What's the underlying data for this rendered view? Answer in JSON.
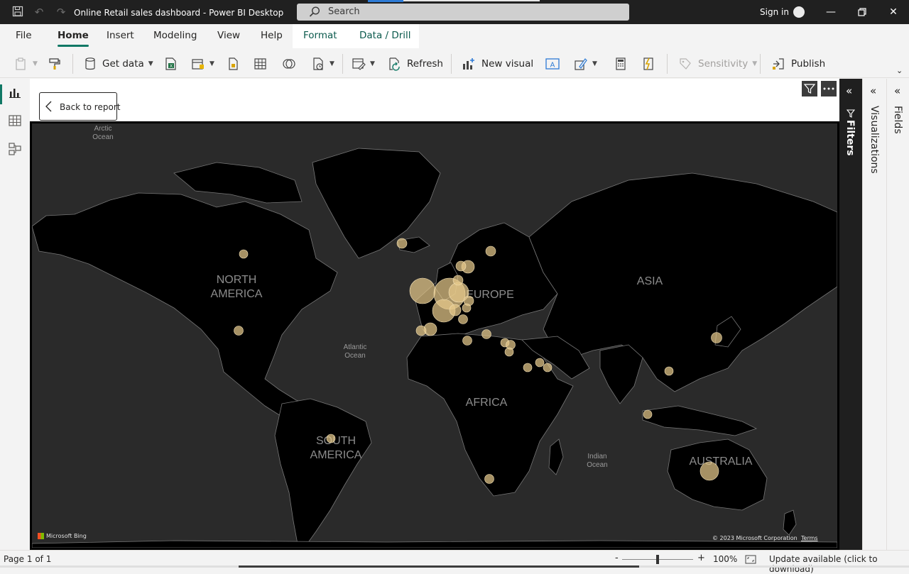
{
  "window": {
    "title": "Online Retail sales dashboard - Power BI Desktop",
    "search_placeholder": "Search",
    "sign_in": "Sign in"
  },
  "menu": {
    "file": "File",
    "home": "Home",
    "insert": "Insert",
    "modeling": "Modeling",
    "view": "View",
    "help": "Help",
    "format": "Format",
    "data_drill": "Data / Drill"
  },
  "ribbon": {
    "get_data": "Get data",
    "refresh": "Refresh",
    "new_visual": "New visual",
    "sensitivity": "Sensitivity",
    "publish": "Publish"
  },
  "canvas": {
    "back_to_report": "Back to report"
  },
  "map": {
    "labels": {
      "arctic_ocean": [
        "Arctic",
        "Ocean"
      ],
      "north_america": [
        "NORTH",
        "AMERICA"
      ],
      "atlantic_ocean": [
        "Atlantic",
        "Ocean"
      ],
      "europe": "EUROPE",
      "asia": "ASIA",
      "africa": "AFRICA",
      "south_america": [
        "SOUTH",
        "AMERICA"
      ],
      "indian_ocean": [
        "Indian",
        "Ocean"
      ],
      "australia": "AUSTRALIA"
    },
    "bing_logo": "Microsoft Bing",
    "copyright": "© 2023 Microsoft Corporation",
    "terms": "Terms",
    "bubble_color": "#e6c98a",
    "land_color": "#000000",
    "water_color": "#2a2a2a",
    "border_color": "#777777"
  },
  "panes": {
    "filters": "Filters",
    "visualizations": "Visualizations",
    "fields": "Fields"
  },
  "status": {
    "page": "Page 1 of 1",
    "zoom": "100%",
    "update": "Update available (click to download)"
  },
  "colors": {
    "accent": "#117865",
    "titlebar": "#202020"
  }
}
